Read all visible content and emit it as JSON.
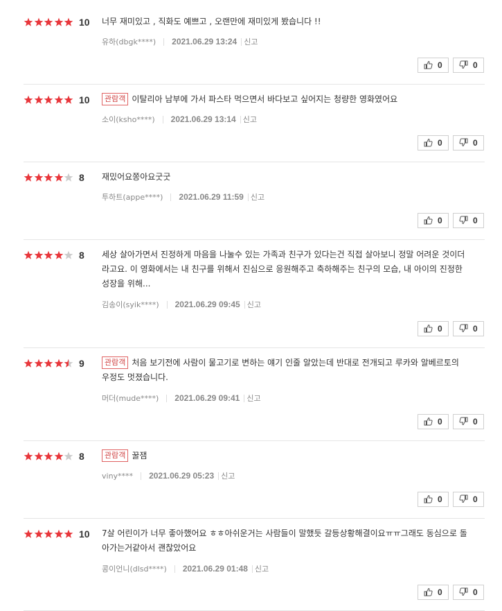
{
  "colors": {
    "star_on": "#e8363b",
    "star_off": "#cccccc",
    "badge": "#d04545"
  },
  "labels": {
    "report": "신고",
    "audience_badge": "관람객"
  },
  "reviews": [
    {
      "rating": 10,
      "stars": 5,
      "score": "10",
      "badge": false,
      "text": "너무 재미있고 , 직화도 예쁘고 , 오랜만에 재미있게 봤습니다 !!",
      "user": "유하(dbgk****)",
      "date": "2021.06.29 13:24",
      "likes": "0",
      "dislikes": "0"
    },
    {
      "rating": 10,
      "stars": 5,
      "score": "10",
      "badge": true,
      "text": "이탈리아 남부에 가서 파스타 먹으면서 바다보고 싶어지는 청량한 영화였어요",
      "user": "소이(ksho****)",
      "date": "2021.06.29 13:14",
      "likes": "0",
      "dislikes": "0"
    },
    {
      "rating": 8,
      "stars": 4,
      "score": "8",
      "badge": false,
      "text": "재밌어요쫑아요굿굿",
      "user": "투하트(appe****)",
      "date": "2021.06.29 11:59",
      "likes": "0",
      "dislikes": "0"
    },
    {
      "rating": 8,
      "stars": 4,
      "score": "8",
      "badge": false,
      "text": "세상 살아가면서 진정하게 마음을 나눌수 있는 가족과 친구가 있다는건 직접 살아보니 정말 어려운 것이더라고요. 이 영화에서는 내 친구를 위해서 진심으로 응원해주고 축하해주는 친구의 모습, 내 아이의 진정한 성장을 위해...",
      "user": "김송이(syik****)",
      "date": "2021.06.29 09:45",
      "likes": "0",
      "dislikes": "0"
    },
    {
      "rating": 9,
      "stars": 4.5,
      "score": "9",
      "badge": true,
      "text": "처음 보기전에 사람이 물고기로 변하는 얘기 인줄 알았는데 반대로 전개되고 루카와 알베르토의 우정도 멋졌습니다.",
      "user": "머더(mude****)",
      "date": "2021.06.29 09:41",
      "likes": "0",
      "dislikes": "0"
    },
    {
      "rating": 8,
      "stars": 4,
      "score": "8",
      "badge": true,
      "text": "꿀잼",
      "user": "viny****",
      "date": "2021.06.29 05:23",
      "likes": "0",
      "dislikes": "0"
    },
    {
      "rating": 10,
      "stars": 5,
      "score": "10",
      "badge": false,
      "text": "7살 어린이가 너무 좋아했어요 ㅎㅎ아쉬운거는 사람들이 말했듯 갈등상황해결이요ㅠㅠ그래도 동심으로 돌아가는거같아서 괜찮았어요",
      "user": "콩이언니(dlsd****)",
      "date": "2021.06.29 01:48",
      "likes": "0",
      "dislikes": "0"
    }
  ]
}
